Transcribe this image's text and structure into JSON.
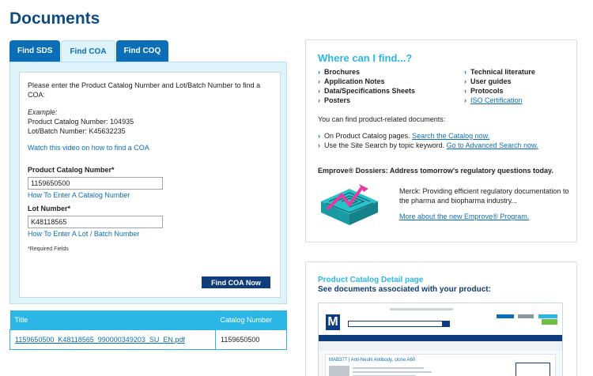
{
  "page": {
    "title": "Documents"
  },
  "tabs": [
    {
      "label": "Find SDS",
      "active": false
    },
    {
      "label": "Find COA",
      "active": true
    },
    {
      "label": "Find COQ",
      "active": false
    }
  ],
  "coa_form": {
    "intro": "Please enter the Product Catalog Number and Lot/Batch Number to find a COA:",
    "example_label": "Example:",
    "example_catalog": "Product Catalog Number: 104935",
    "example_lot": "Lot/Batch Number: K45632235",
    "video_link": "Watch this video on how to find a COA",
    "catalog_label": "Product Catalog Number*",
    "catalog_value": "1159650500",
    "catalog_help": "How To Enter A Catalog Number",
    "lot_label": "Lot Number*",
    "lot_value": "K48118565",
    "lot_help": "How To Enter A Lot / Batch Number",
    "required_note": "*Required Fields",
    "submit_label": "Find COA Now"
  },
  "results": {
    "columns": [
      "Title",
      "Catalog Number"
    ],
    "rows": [
      {
        "title": "1159650500_K48118565_990000349203_SU_EN.pdf",
        "catalog": "1159650500"
      }
    ]
  },
  "where_card": {
    "title": "Where can I find...?",
    "left_items": [
      "Brochures",
      "Application Notes",
      "Data/Specifications Sheets",
      "Posters"
    ],
    "right_items": [
      "Technical literature",
      "User guides",
      "Protocols"
    ],
    "right_link": "ISO Certification",
    "related_text": "You can find product-related documents:",
    "catalog_text": "On Product Catalog pages.",
    "catalog_link": "Search the Catalog now.",
    "site_text": "Use the Site Search by topic keyword.",
    "site_link": "Go to Advanced Search now.",
    "dossier_title": "Emprove® Dossiers: Address tomorrow's regulatory questions today.",
    "dossier_text": "Merck: Providing efficient regulatory documentation to the pharma and biopharma industry...",
    "dossier_link": "More about the new Emprove® Program."
  },
  "catalog_card": {
    "title": "Product Catalog Detail page",
    "subtitle": "See documents associated with your product:",
    "thumb_logo": "M",
    "thumb_heading": "MAB377 | Anti-NeuN Antibody, clone A60"
  },
  "colors": {
    "brand_dark": "#0f3c7a",
    "brand": "#0b6eb6",
    "accent": "#2bb7e6",
    "tab_panel": "#dff3fb"
  }
}
